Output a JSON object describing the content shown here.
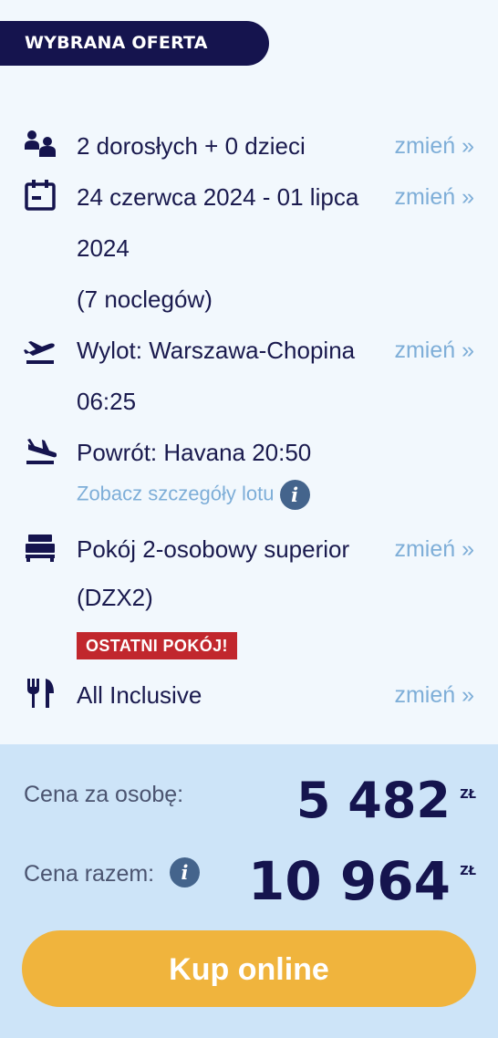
{
  "header": {
    "badge": "WYBRANA OFERTA"
  },
  "offer": {
    "travelers": {
      "icon": "people-icon",
      "text": "2 dorosłych + 0 dzieci",
      "change": "zmień »"
    },
    "dates": {
      "icon": "calendar-icon",
      "line1": "24 czerwca 2024 - 01 lipca",
      "line2": "2024",
      "line3": "(7 noclegów)",
      "change": "zmień »"
    },
    "departure": {
      "icon": "plane-takeoff-icon",
      "line1": "Wylot: Warszawa-Chopina",
      "line2": "06:25",
      "change": "zmień »"
    },
    "return": {
      "icon": "plane-landing-icon",
      "line1": "Powrót: Havana 20:50",
      "details_link": "Zobacz szczegóły lotu",
      "info": "i"
    },
    "room": {
      "icon": "bed-icon",
      "line1": "Pokój 2-osobowy superior",
      "line2": "(DZX2)",
      "tag": "OSTATNI POKÓJ!",
      "change": "zmień »"
    },
    "board": {
      "icon": "fork-knife-icon",
      "text": "All Inclusive",
      "change": "zmień »"
    }
  },
  "pricing": {
    "per_person_label": "Cena za osobę:",
    "per_person_value": "5 482",
    "total_label": "Cena razem:",
    "total_info": "i",
    "total_value": "10 964",
    "currency": "ZŁ"
  },
  "cta": {
    "buy_label": "Kup online"
  },
  "colors": {
    "navy": "#15144e",
    "link": "#7eaed8",
    "tag_red": "#c1272d",
    "button": "#f0b43d",
    "panel": "#cde4f8"
  }
}
